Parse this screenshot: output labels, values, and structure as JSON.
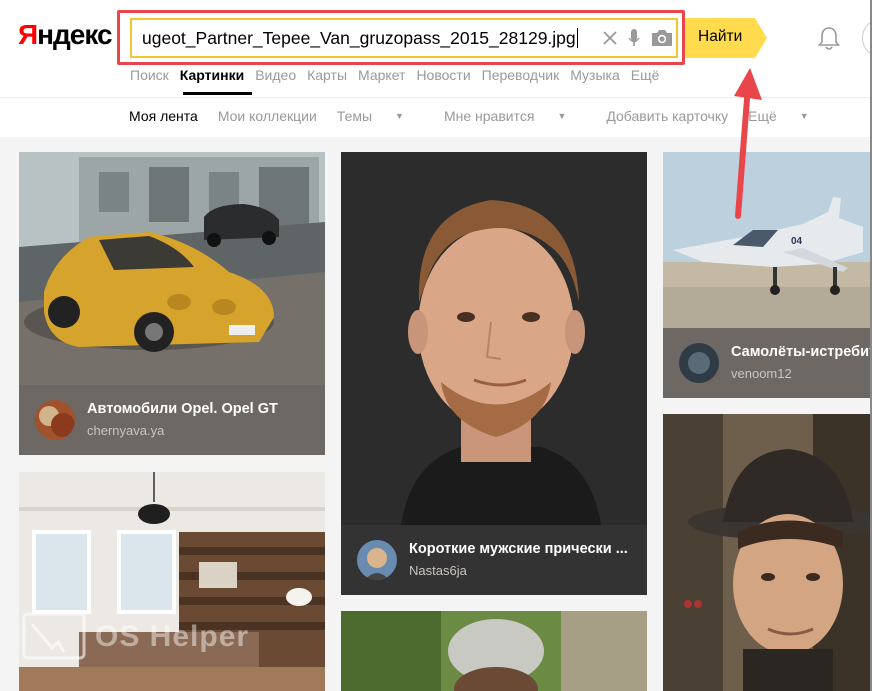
{
  "header": {
    "logo_first": "Я",
    "logo_rest": "ндекс",
    "search": {
      "value": "ugeot_Partner_Tepee_Van_gruzopass_2015_28129.jpg"
    },
    "find_button": "Найти",
    "icons": [
      "clear-icon",
      "microphone-icon",
      "camera-icon",
      "bell-icon"
    ]
  },
  "services": [
    "Поиск",
    "Картинки",
    "Видео",
    "Карты",
    "Маркет",
    "Новости",
    "Переводчик",
    "Музыка",
    "Ещё"
  ],
  "services_active": "Картинки",
  "subnav": {
    "my_feed": "Моя лента",
    "my_collections": "Мои коллекции",
    "topics": "Темы",
    "likes": "Мне нравится",
    "add_card": "Добавить карточку",
    "more": "Ещё"
  },
  "cards": [
    {
      "title": "Автомобили Opel. Opel GT",
      "author": "chernyava.ya"
    },
    {
      "title": "Короткие мужские прически ...",
      "author": "Nastas6ja"
    },
    {
      "title": "Самолёты-истребит",
      "author": "venoom12"
    }
  ],
  "watermark": "OS Helper",
  "colors": {
    "accent_yellow": "#ffdb4d",
    "highlight_red": "#e8464a",
    "logo_red": "#ff0000"
  }
}
